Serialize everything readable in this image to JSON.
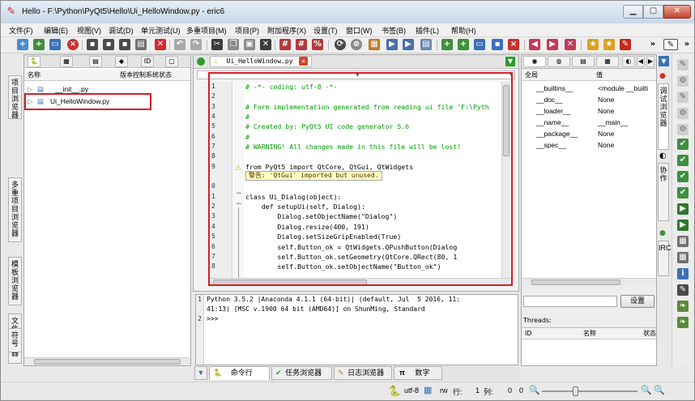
{
  "window": {
    "title": "Hello - F:\\Python\\PyQt5\\Hello\\Ui_HelloWindow.py - eric6"
  },
  "menu": [
    "文件(F)",
    "编辑(E)",
    "视图(V)",
    "调试(D)",
    "单元测试(U)",
    "多重项目(M)",
    "项目(P)",
    "附加程序(X)",
    "设置(T)",
    "窗口(W)",
    "书签(B)",
    "插件(L)",
    "帮助(H)"
  ],
  "project_browser": {
    "col_name": "名称",
    "col_vcs": "版本控制系统状态",
    "items": [
      "__init__.py",
      "Ui_HelloWindow.py"
    ]
  },
  "left_vtabs": [
    "项目浏览器",
    "多重项目浏览器",
    "模板浏览器",
    "文件浏览器",
    "符号"
  ],
  "editor": {
    "tab_label": "Ui_HelloWindow.py",
    "line_numbers": [
      "1",
      "2",
      "3",
      "4",
      "5",
      "6",
      "7",
      "8",
      "9",
      "",
      "0",
      "1",
      "2",
      "3",
      "4",
      "5",
      "6",
      "7",
      "8"
    ],
    "lines": [
      "# -*- coding: utf-8 -*-",
      "",
      "# Form implementation generated from reading ui file 'F:\\Pyth",
      "#",
      "# Created by: PyQt5 UI code generator 5.6",
      "#",
      "# WARNING! All changes made in this file will be lost!",
      "",
      "from PyQt5 import QtCore, QtGui, QtWidgets",
      "",
      "",
      "class Ui_Dialog(object):",
      "    def setupUi(self, Dialog):",
      "        Dialog.setObjectName(\"Dialog\")",
      "        Dialog.resize(400, 191)",
      "        Dialog.setSizeGripEnabled(True)",
      "        self.Button_ok = QtWidgets.QPushButton(Dialog",
      "        self.Button_ok.setGeometry(QtCore.QRect(80, 1",
      "        self.Button_ok.setObjectName(\"Button_ok\")"
    ],
    "warning_text": "警告: 'QtGui' imported but unused."
  },
  "console": {
    "line1": "Python 3.5.2 |Anaconda 4.1.1 (64-bit)| (default, Jul  5 2016, 11:",
    "line2": "41:13) [MSC v.1900 64 bit (AMD64)] on ShunMing, Standard",
    "prompt": ">>>"
  },
  "bottom_tabs": [
    "命令行",
    "任务浏览器",
    "日志浏览器",
    "数字"
  ],
  "globals": {
    "col_global": "全局",
    "col_value": "值",
    "rows": [
      {
        "name": "__builtins__",
        "value": "<module __builti"
      },
      {
        "name": "__doc__",
        "value": "None"
      },
      {
        "name": "__loader__",
        "value": "None"
      },
      {
        "name": "__name__",
        "value": "__main__"
      },
      {
        "name": "__package__",
        "value": "None"
      },
      {
        "name": "__spec__",
        "value": "None"
      }
    ],
    "set_button": "设置"
  },
  "threads": {
    "label": "Threads:",
    "col_id": "ID",
    "col_name": "名称",
    "col_state": "状态"
  },
  "right_vtabs": [
    "调试浏览器",
    "协作",
    "IRC"
  ],
  "status": {
    "encoding": "utf-8",
    "mode": "rw",
    "line_label": "行:",
    "line_value": "1",
    "col_label": "列:",
    "col_value": "0",
    "zoom": "0"
  }
}
